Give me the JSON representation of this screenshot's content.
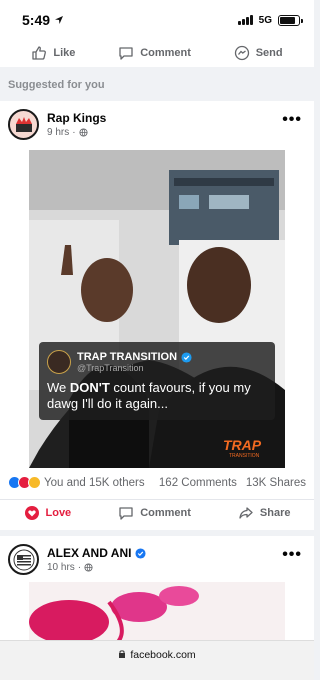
{
  "status": {
    "time": "5:49",
    "network": "5G",
    "battery_level": 0.85
  },
  "top_actions": {
    "like": "Like",
    "comment": "Comment",
    "send": "Send"
  },
  "section": {
    "label": "Suggested for you"
  },
  "post1": {
    "page_name": "Rap Kings",
    "time": "9 hrs",
    "quote": {
      "name": "TRAP TRANSITION",
      "handle": "@TrapTransition",
      "text_before": "We ",
      "text_bold": "DON'T",
      "text_after": " count favours, if you my dawg I'll do it again...",
      "logo_text": "TRAP",
      "logo_sub": "TRANSITION"
    },
    "reactions_text": "You and 15K others",
    "comments": "162 Comments",
    "shares": "13K Shares",
    "actions": {
      "love": "Love",
      "comment": "Comment",
      "share": "Share"
    }
  },
  "post2": {
    "page_name": "ALEX AND ANI",
    "time": "10 hrs"
  },
  "browser": {
    "url": "facebook.com"
  },
  "colors": {
    "love_red": "#e41e3f",
    "verified_blue": "#1877f2",
    "muted": "#65676b",
    "trap_orange": "#f26a21"
  }
}
